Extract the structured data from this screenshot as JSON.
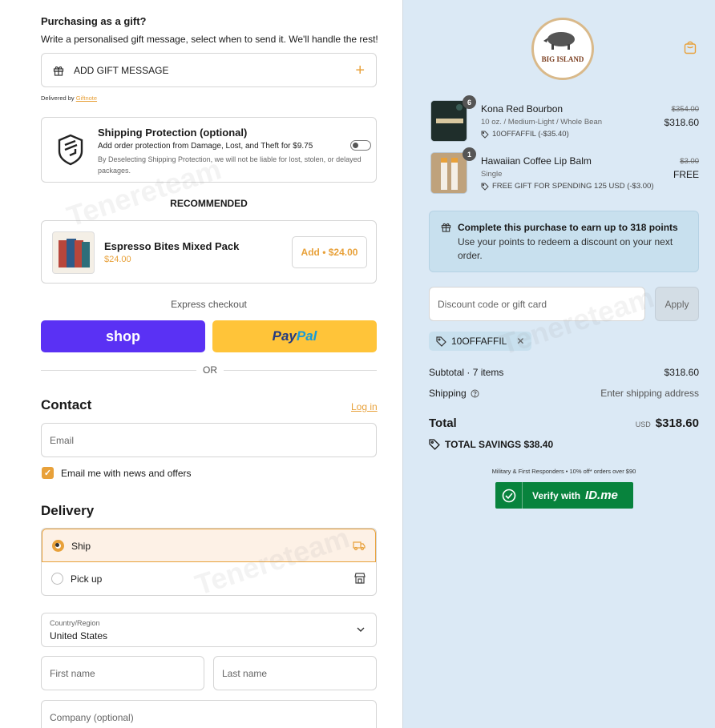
{
  "gift": {
    "title": "Purchasing as a gift?",
    "description": "Write a personalised gift message, select when to send it. We'll handle the rest!",
    "button_label": "ADD GIFT MESSAGE",
    "delivered_by": "Delivered by",
    "delivered_link": "Giftnote"
  },
  "shipping_protection": {
    "title": "Shipping Protection (optional)",
    "subtitle": "Add order protection from Damage, Lost, and Theft for $9.75",
    "note": "By Deselecting Shipping Protection, we will not be liable for lost, stolen, or delayed packages.",
    "enabled": false
  },
  "recommended": {
    "heading": "RECOMMENDED",
    "product_name": "Espresso Bites Mixed Pack",
    "price": "$24.00",
    "add_label": "Add • $24.00"
  },
  "express": {
    "label": "Express checkout",
    "shop_label": "shop",
    "paypal_a": "Pay",
    "paypal_b": "Pal",
    "or_label": "OR"
  },
  "contact": {
    "heading": "Contact",
    "login_label": "Log in",
    "email_placeholder": "Email",
    "newsletter_label": "Email me with news and offers",
    "newsletter_checked": true
  },
  "delivery": {
    "heading": "Delivery",
    "options": [
      "Ship",
      "Pick up"
    ],
    "selected": "Ship",
    "country_label": "Country/Region",
    "country_value": "United States",
    "first_name_placeholder": "First name",
    "last_name_placeholder": "Last name",
    "company_placeholder": "Company (optional)"
  },
  "cart": {
    "brand_top": "BIG ISLAND",
    "items": [
      {
        "name": "Kona Red Bourbon",
        "qty": "6",
        "variant": "10 oz. / Medium-Light / Whole Bean",
        "discount": "10OFFAFFIL (-$35.40)",
        "original_price": "$354.00",
        "price": "$318.60"
      },
      {
        "name": "Hawaiian Coffee Lip Balm",
        "qty": "1",
        "variant": "Single",
        "discount": "FREE GIFT FOR SPENDING 125 USD (-$3.00)",
        "original_price": "$3.00",
        "price": "FREE"
      }
    ],
    "points_title": "Complete this purchase to earn up to 318 points",
    "points_desc": "Use your points to redeem a discount on your next order.",
    "discount_placeholder": "Discount code or gift card",
    "apply_label": "Apply",
    "applied_code": "10OFFAFFIL",
    "subtotal_label": "Subtotal · 7 items",
    "subtotal_value": "$318.60",
    "shipping_label": "Shipping",
    "shipping_value": "Enter shipping address",
    "total_label": "Total",
    "total_currency": "USD",
    "total_value": "$318.60",
    "savings_label": "TOTAL SAVINGS $38.40",
    "military_text": "Military & First Responders • 10% off* orders over $90",
    "idme_label": "Verify with",
    "idme_brand": "ID.me"
  },
  "watermark": "Tenereteam",
  "colors": {
    "accent": "#e8a13a",
    "shop": "#5a31f4",
    "paypal": "#ffc439",
    "summary_bg": "#dbe9f5",
    "idme": "#08833d"
  }
}
